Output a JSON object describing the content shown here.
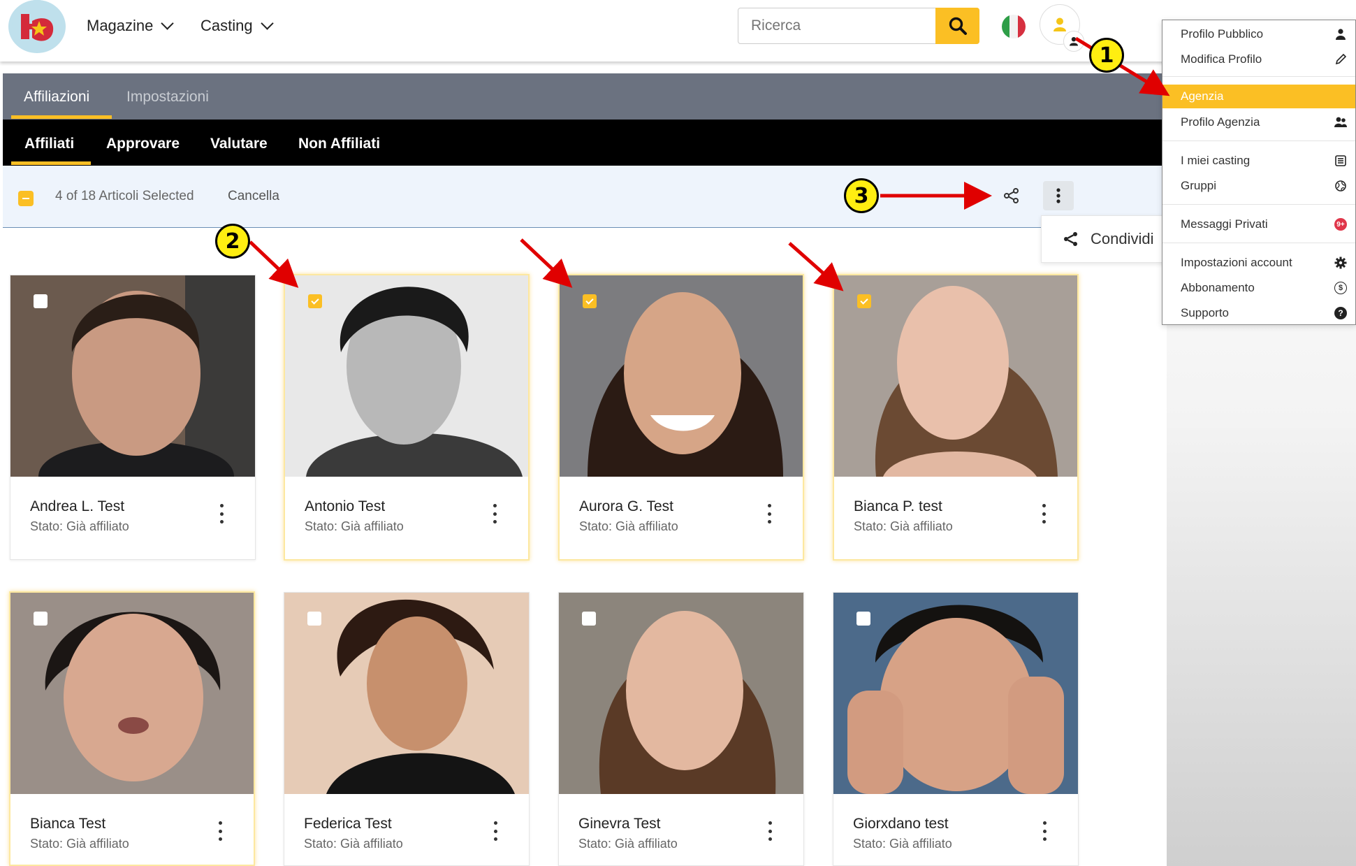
{
  "header": {
    "nav": [
      {
        "label": "Magazine"
      },
      {
        "label": "Casting"
      }
    ],
    "search": {
      "placeholder": "Ricerca"
    }
  },
  "tabs_primary": [
    {
      "label": "Affiliazioni",
      "active": true
    },
    {
      "label": "Impostazioni",
      "active": false
    }
  ],
  "tabs_secondary": [
    {
      "label": "Affiliati",
      "active": true
    },
    {
      "label": "Approvare"
    },
    {
      "label": "Valutare"
    },
    {
      "label": "Non Affiliati"
    }
  ],
  "selection": {
    "text": "4 of 18 Articoli Selected",
    "cancel_label": "Cancella"
  },
  "share_popup": {
    "label": "Condividi"
  },
  "cards": [
    {
      "name": "Andrea L. Test",
      "status": "Stato: Già affiliato",
      "selected": false
    },
    {
      "name": "Antonio Test",
      "status": "Stato: Già affiliato",
      "selected": true
    },
    {
      "name": "Aurora G. Test",
      "status": "Stato: Già affiliato",
      "selected": true
    },
    {
      "name": "Bianca P. test",
      "status": "Stato: Già affiliato",
      "selected": true
    },
    {
      "name": "Bianca Test",
      "status": "Stato: Già affiliato",
      "selected": false
    },
    {
      "name": "Federica Test",
      "status": "Stato: Già affiliato",
      "selected": false
    },
    {
      "name": "Ginevra Test",
      "status": "Stato: Già affiliato",
      "selected": false
    },
    {
      "name": "Giorxdano test",
      "status": "Stato: Già affiliato",
      "selected": false
    }
  ],
  "user_menu": {
    "items": [
      {
        "label": "Profilo Pubblico",
        "icon": "user-icon"
      },
      {
        "label": "Modifica Profilo",
        "icon": "pencil-icon"
      },
      {
        "label": "Agenzia",
        "icon": "",
        "highlighted": true
      },
      {
        "label": "Profilo Agenzia",
        "icon": "users-icon"
      },
      {
        "label": "I miei casting",
        "icon": "list-icon"
      },
      {
        "label": "Gruppi",
        "icon": "globe-icon"
      },
      {
        "label": "Messaggi Privati",
        "icon": "message-badge-icon",
        "badge": "9+"
      },
      {
        "label": "Impostazioni account",
        "icon": "gear-icon"
      },
      {
        "label": "Abbonamento",
        "icon": "dollar-icon",
        "glyph": "$"
      },
      {
        "label": "Supporto",
        "icon": "help-icon",
        "glyph": "?"
      }
    ]
  },
  "annotations": [
    "1",
    "2",
    "3"
  ],
  "colors": {
    "accent": "#fbbf24",
    "tabbar_gray": "#6b7280",
    "tabbar_black": "#000000",
    "annotation_arrow": "#e00000",
    "annotation_badge": "#ffee11"
  }
}
